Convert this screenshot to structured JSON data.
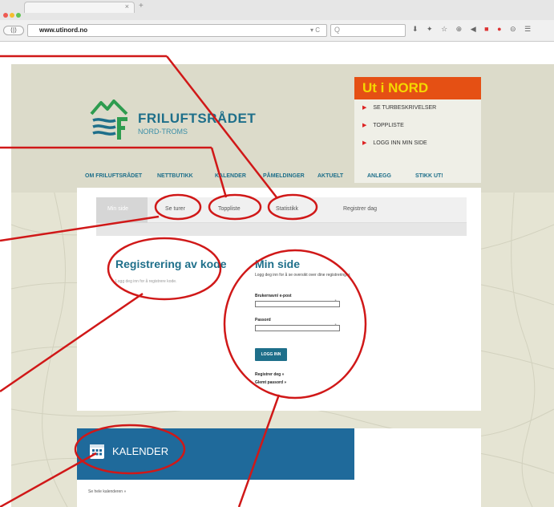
{
  "browser": {
    "url": "www.utinord.no",
    "back_glyph": "⟨|⟩",
    "reload_glyph": "▾ C",
    "search_glyph": "Q",
    "newtab_glyph": "+",
    "tab_close_glyph": "×",
    "toolbar_icons": "⬇ ✦ ☆ ⊕ ◀"
  },
  "colors": {
    "brand_blue": "#1e6f8a",
    "orange": "#e55014",
    "yellow": "#f5d800",
    "annotation_red": "#d01818",
    "kalender_blue": "#1f6a9b"
  },
  "logo": {
    "title": "FRILUFTSRÅDET",
    "subtitle": "NORD-TROMS",
    "icon": "mountain-waves-icon"
  },
  "utinord": {
    "title": "Ut i NORD",
    "items": [
      {
        "label": "SE TURBESKRIVELSER"
      },
      {
        "label": "TOPPLISTE"
      },
      {
        "label": "LOGG INN MIN SIDE"
      }
    ]
  },
  "menu": [
    {
      "label": "OM FRILUFTSRÅDET"
    },
    {
      "label": "NETTBUTIKK"
    },
    {
      "label": "KALENDER"
    },
    {
      "label": "PÅMELDINGER"
    },
    {
      "label": "AKTUELT"
    },
    {
      "label": "ANLEGG"
    },
    {
      "label": "STIKK UT!"
    }
  ],
  "page_tabs": [
    {
      "label": "Min side"
    },
    {
      "label": "Se turer"
    },
    {
      "label": "Toppliste"
    },
    {
      "label": "Statistikk"
    },
    {
      "label": "Registrer dag"
    }
  ],
  "registrering": {
    "title": "Registrering av kode",
    "text": "Logg deg inn for å registrere kode."
  },
  "minside": {
    "title": "Min side",
    "text": "Logg deg inn for å se oversikt over dine registreringer.",
    "username_label": "Brukernavn/ e-post",
    "password_label": "Passord",
    "login_button": "LOGG INN",
    "register_link": "Registrer deg »",
    "forgot_link": "Glemt passord »"
  },
  "kalender": {
    "title": "KALENDER",
    "link": "Se hele kalenderen »",
    "icon": "calendar-icon"
  }
}
